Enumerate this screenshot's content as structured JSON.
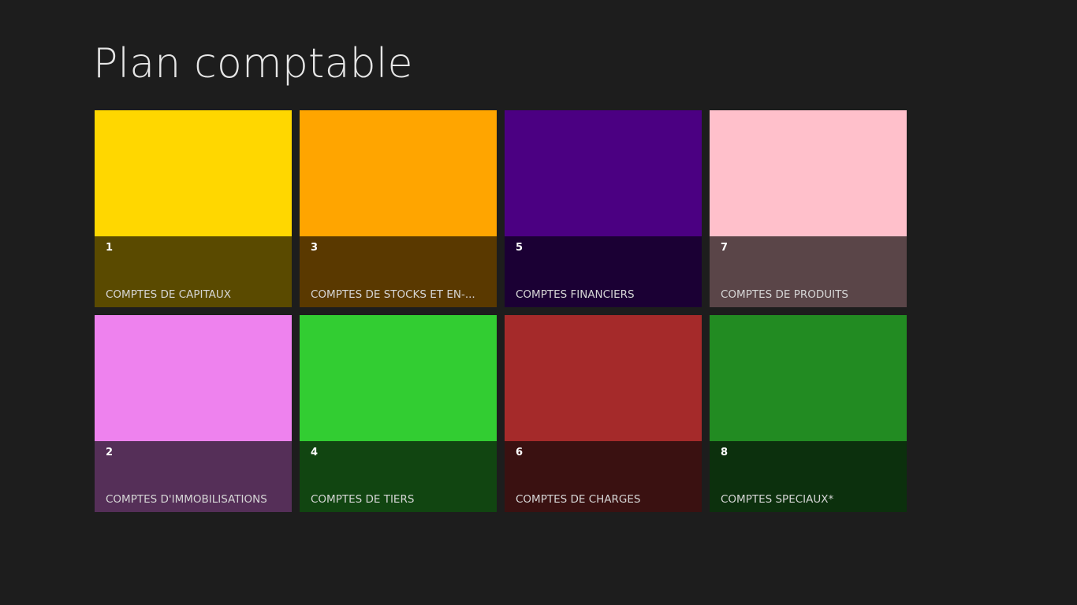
{
  "page": {
    "title": "Plan comptable",
    "background": "#1d1d1d"
  },
  "tiles": [
    {
      "number": "1",
      "label": "COMPTES DE CAPITAUX",
      "color": "#ffd700",
      "overlay": "#5a4a00"
    },
    {
      "number": "2",
      "label": "COMPTES D'IMMOBILISATIONS",
      "color": "#ee82ee",
      "overlay": "#552f58"
    },
    {
      "number": "3",
      "label": "COMPTES DE STOCKS ET EN-...",
      "color": "#ffa500",
      "overlay": "#5a3900"
    },
    {
      "number": "4",
      "label": "COMPTES DE TIERS",
      "color": "#32cd32",
      "overlay": "#114511"
    },
    {
      "number": "5",
      "label": "COMPTES FINANCIERS",
      "color": "#4b0082",
      "overlay": "#1b0034"
    },
    {
      "number": "6",
      "label": "COMPTES DE CHARGES",
      "color": "#a52a2a",
      "overlay": "#3a1111"
    },
    {
      "number": "7",
      "label": "COMPTES DE PRODUITS",
      "color": "#ffc0cb",
      "overlay": "#5a4548"
    },
    {
      "number": "8",
      "label": "COMPTES SPECIAUX*",
      "color": "#228b22",
      "overlay": "#0c300d"
    }
  ]
}
